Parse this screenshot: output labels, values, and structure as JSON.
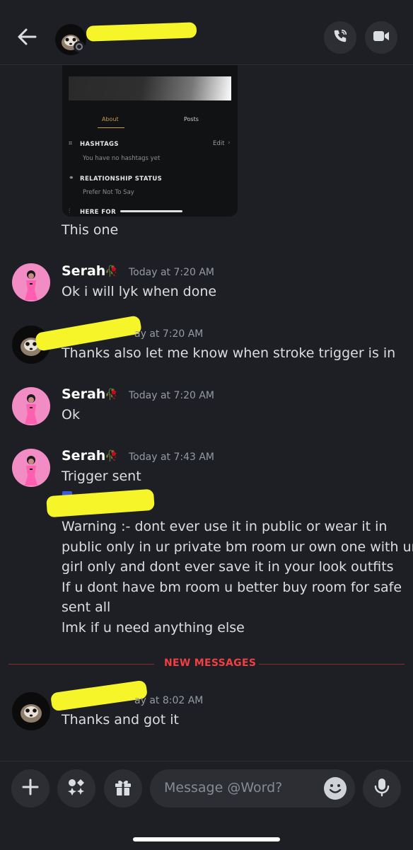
{
  "header": {
    "back_icon": "arrow-left-icon",
    "call_icon": "phone-call-icon",
    "video_icon": "video-camera-icon"
  },
  "embed": {
    "tabs": [
      "About",
      "Posts"
    ],
    "hashtags_title": "HASHTAGS",
    "hashtags_edit": "Edit",
    "hashtags_empty": "You have no hashtags yet",
    "relationship_title": "RELATIONSHIP STATUS",
    "relationship_value": "Prefer Not To Say",
    "here_for_title": "HERE FOR"
  },
  "messages": {
    "m0_text": "This one",
    "m1": {
      "author": "Serah",
      "time": "Today at 7:20 AM",
      "text": "Ok i will lyk when done"
    },
    "m2": {
      "time_partial": "ay at 7:20 AM",
      "text": "Thanks also let me know when stroke trigger is in"
    },
    "m3": {
      "author": "Serah",
      "time": "Today at 7:20 AM",
      "text": "Ok"
    },
    "m4": {
      "author": "Serah",
      "time": "Today at 7:43 AM",
      "text": "Trigger sent",
      "lines": [
        "Warning :- dont ever use it in public or wear it in",
        "public only in ur private bm room ur own one with ur",
        "girl only and dont ever save it in your look outfits",
        "If u dont have bm room u better buy room for safe",
        "sent all",
        "lmk if u need anything else"
      ]
    },
    "new_messages_label": "NEW MESSAGES",
    "m5": {
      "time_partial": "ay at 8:02 AM",
      "text": "Thanks and got it"
    }
  },
  "composer": {
    "placeholder": "Message @Word?",
    "add_icon": "plus-icon",
    "apps_icon": "apps-icon",
    "gift_icon": "gift-icon",
    "emoji_icon": "emoji-icon",
    "mic_icon": "microphone-icon"
  },
  "colors": {
    "background": "#1e1f24",
    "new_messages": "#f23f42",
    "redaction": "#f5f52a"
  }
}
